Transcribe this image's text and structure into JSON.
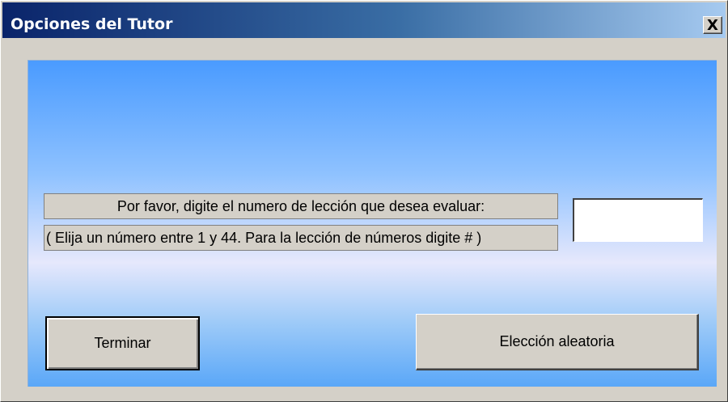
{
  "window": {
    "title": "Opciones del Tutor",
    "close_label": "X"
  },
  "prompt": {
    "line1": "Por favor, digite el numero de lección que desea evaluar:",
    "line2": "( Elija un número entre 1 y 44. Para la lección de números digite # )"
  },
  "lesson_input": {
    "value": "",
    "placeholder": ""
  },
  "buttons": {
    "terminar": "Terminar",
    "random": "Elección aleatoria"
  },
  "colors": {
    "titlebar_start": "#0a246a",
    "titlebar_end": "#a6caf0",
    "client_top": "#4a9bff",
    "client_mid": "#e6e8fc",
    "face": "#d4d0c8"
  }
}
